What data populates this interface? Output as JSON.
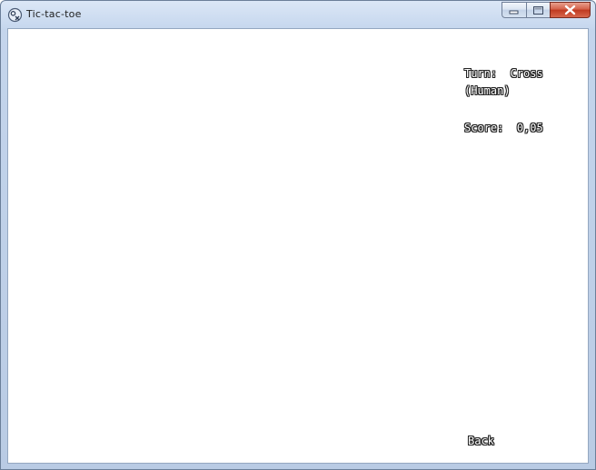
{
  "window": {
    "title": "Tic-tac-toe",
    "controls": {
      "minimize": "minimize-icon",
      "maximize": "maximize-icon",
      "close": "close-icon"
    }
  },
  "game": {
    "turn_label": "Turn:",
    "turn_value": "Cross",
    "player": "(Human)",
    "score_label": "Score:",
    "score_value": "0,05",
    "back_label": "Back"
  },
  "colors": {
    "titlebar": "#c6d7ee",
    "close_button": "#c0391f",
    "client_background": "#ffffff",
    "text_outline": "#222222"
  }
}
